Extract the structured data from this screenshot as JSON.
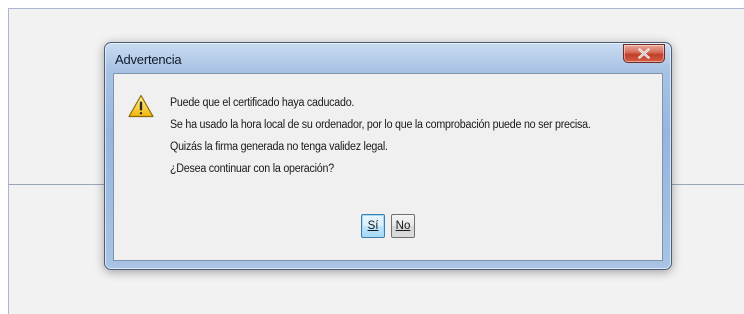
{
  "dialog": {
    "title": "Advertencia",
    "close_icon": "close-x-icon",
    "warning_icon": "warning-triangle-icon",
    "messages": [
      "Puede que el certificado haya caducado.",
      "Se ha usado la hora local de su ordenador, por lo que la comprobación puede no ser precisa.",
      "Quizás la firma generada no tenga validez legal.",
      "¿Desea continuar con la operación?"
    ],
    "buttons": {
      "yes_label": "Sí",
      "no_label": "No"
    }
  },
  "colors": {
    "title_bar": "#a9c3e4",
    "close_button": "#c1402b",
    "content_background": "#f0f0f0",
    "warning_icon": "#f5c518",
    "default_button_border": "#3c7fb1"
  }
}
